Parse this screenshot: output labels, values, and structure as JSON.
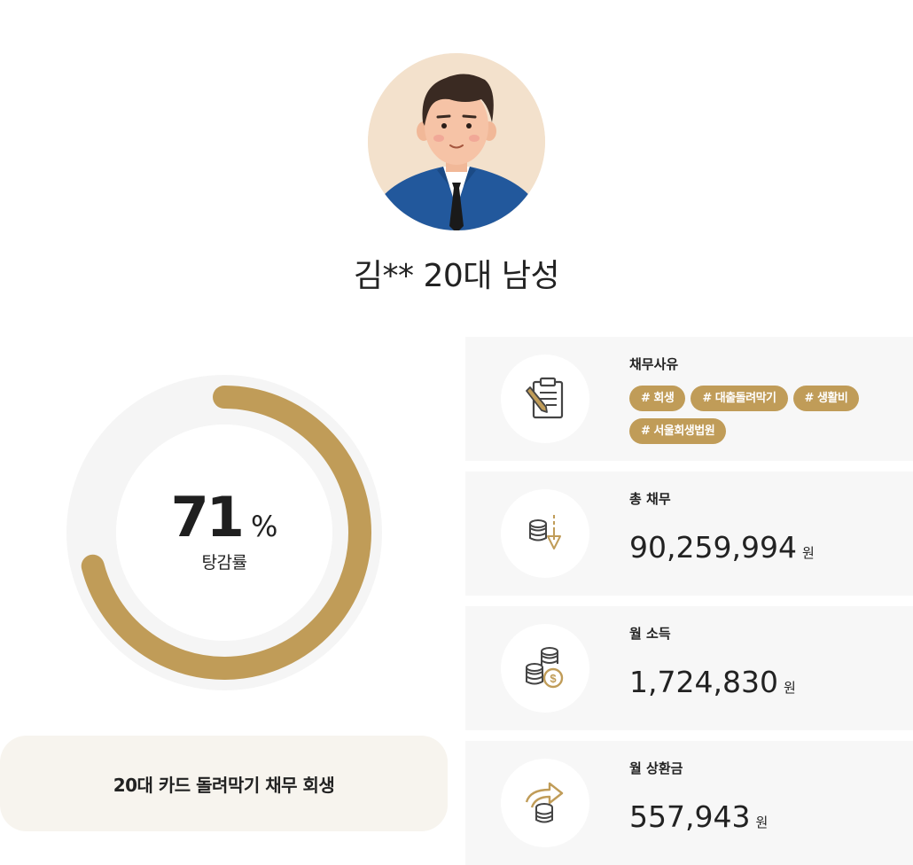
{
  "profile": {
    "avatar_icon": "man-in-suit-avatar",
    "name": "김** 20대 남성"
  },
  "reduction": {
    "value": "71",
    "unit": "%",
    "label": "탕감률",
    "percent": 71,
    "accent_color": "#c09c58",
    "track_color": "#f5f5f5"
  },
  "case_title": "20대 카드 돌려막기 채무 회생",
  "cards": {
    "reason": {
      "icon": "clipboard-pencil-icon",
      "title": "채무사유",
      "tags": [
        "# 회생",
        "# 대출돌려막기",
        "# 생활비",
        "# 서울회생법원"
      ]
    },
    "total_debt": {
      "icon": "coins-down-arrow-icon",
      "title": "총 채무",
      "amount": "90,259,994",
      "unit": "원"
    },
    "monthly_income": {
      "icon": "coin-stacks-icon",
      "title": "월 소득",
      "amount": "1,724,830",
      "unit": "원"
    },
    "monthly_repayment": {
      "icon": "coins-return-arrow-icon",
      "title": "월 상환금",
      "amount": "557,943",
      "unit": "원"
    }
  },
  "colors": {
    "accent": "#c09c58",
    "card_bg": "#f7f7f7",
    "case_bg": "#f7f4ee"
  }
}
